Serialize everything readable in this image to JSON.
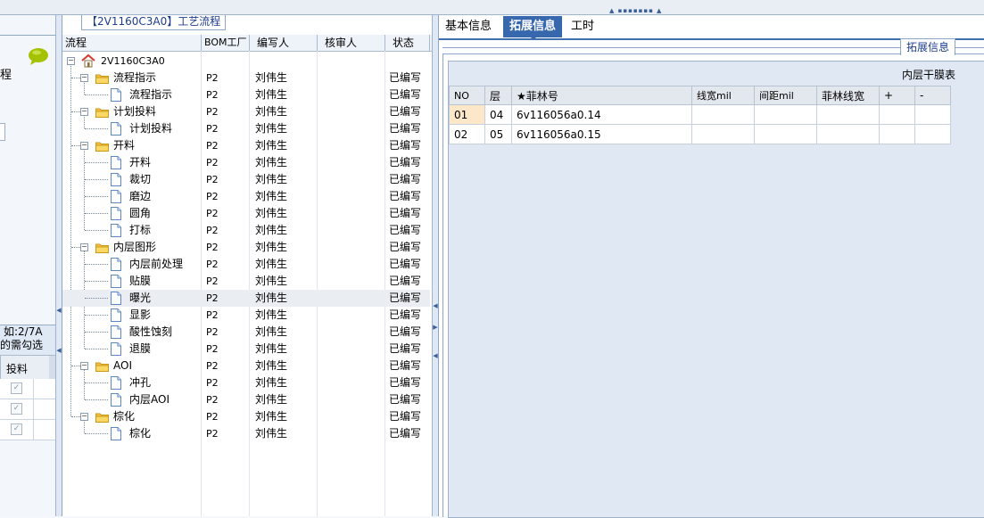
{
  "window": {
    "panel_title": "【2V1160C3A0】工艺流程"
  },
  "left_panel": {
    "label_cheng": "程",
    "hint_line1": "如:2/7A",
    "hint_line2": "的需勾选",
    "column_header": "投料",
    "rows": [
      {
        "checked": true
      },
      {
        "checked": true
      },
      {
        "checked": true
      }
    ]
  },
  "tree": {
    "headers": {
      "flow": "流程",
      "bom_factory": "BOM工厂",
      "author": "编写人",
      "reviewer": "核审人",
      "status": "状态"
    },
    "root": {
      "label": "2V1160C3A0"
    },
    "nodes": [
      {
        "label": "流程指示",
        "type": "folder",
        "bom": "P2",
        "author": "刘伟生",
        "reviewer": "",
        "status": "已编写"
      },
      {
        "label": "流程指示",
        "type": "doc",
        "bom": "P2",
        "author": "刘伟生",
        "reviewer": "",
        "status": "已编写"
      },
      {
        "label": "计划投料",
        "type": "folder",
        "bom": "P2",
        "author": "刘伟生",
        "reviewer": "",
        "status": "已编写"
      },
      {
        "label": "计划投料",
        "type": "doc",
        "bom": "P2",
        "author": "刘伟生",
        "reviewer": "",
        "status": "已编写"
      },
      {
        "label": "开料",
        "type": "folder",
        "bom": "P2",
        "author": "刘伟生",
        "reviewer": "",
        "status": "已编写"
      },
      {
        "label": "开料",
        "type": "doc",
        "bom": "P2",
        "author": "刘伟生",
        "reviewer": "",
        "status": "已编写"
      },
      {
        "label": "裁切",
        "type": "doc",
        "bom": "P2",
        "author": "刘伟生",
        "reviewer": "",
        "status": "已编写"
      },
      {
        "label": "磨边",
        "type": "doc",
        "bom": "P2",
        "author": "刘伟生",
        "reviewer": "",
        "status": "已编写"
      },
      {
        "label": "圆角",
        "type": "doc",
        "bom": "P2",
        "author": "刘伟生",
        "reviewer": "",
        "status": "已编写"
      },
      {
        "label": "打标",
        "type": "doc",
        "bom": "P2",
        "author": "刘伟生",
        "reviewer": "",
        "status": "已编写"
      },
      {
        "label": "内层图形",
        "type": "folder",
        "bom": "P2",
        "author": "刘伟生",
        "reviewer": "",
        "status": "已编写"
      },
      {
        "label": "内层前处理",
        "type": "doc",
        "bom": "P2",
        "author": "刘伟生",
        "reviewer": "",
        "status": "已编写"
      },
      {
        "label": "贴膜",
        "type": "doc",
        "bom": "P2",
        "author": "刘伟生",
        "reviewer": "",
        "status": "已编写"
      },
      {
        "label": "曝光",
        "type": "doc",
        "bom": "P2",
        "author": "刘伟生",
        "reviewer": "",
        "status": "已编写",
        "selected": true
      },
      {
        "label": "显影",
        "type": "doc",
        "bom": "P2",
        "author": "刘伟生",
        "reviewer": "",
        "status": "已编写"
      },
      {
        "label": "酸性蚀刻",
        "type": "doc",
        "bom": "P2",
        "author": "刘伟生",
        "reviewer": "",
        "status": "已编写"
      },
      {
        "label": "退膜",
        "type": "doc",
        "bom": "P2",
        "author": "刘伟生",
        "reviewer": "",
        "status": "已编写"
      },
      {
        "label": "AOI",
        "type": "folder",
        "bom": "P2",
        "author": "刘伟生",
        "reviewer": "",
        "status": "已编写"
      },
      {
        "label": "冲孔",
        "type": "doc",
        "bom": "P2",
        "author": "刘伟生",
        "reviewer": "",
        "status": "已编写"
      },
      {
        "label": "内层AOI",
        "type": "doc",
        "bom": "P2",
        "author": "刘伟生",
        "reviewer": "",
        "status": "已编写"
      },
      {
        "label": "棕化",
        "type": "folder",
        "bom": "P2",
        "author": "刘伟生",
        "reviewer": "",
        "status": "已编写"
      },
      {
        "label": "棕化",
        "type": "doc",
        "bom": "P2",
        "author": "刘伟生",
        "reviewer": "",
        "status": "已编写"
      }
    ]
  },
  "right_panel": {
    "tabs": [
      {
        "label": "基本信息",
        "active": false
      },
      {
        "label": "拓展信息",
        "active": true
      },
      {
        "label": "工时",
        "active": false
      }
    ],
    "group_label": "拓展信息",
    "grid_caption": "内层干膜表",
    "grid": {
      "headers": [
        "NO",
        "层",
        "★菲林号",
        "线宽mil",
        "间距mil",
        "菲林线宽",
        "+",
        "-"
      ],
      "rows": [
        [
          "01",
          "04",
          "6v116056a0.14",
          "",
          "",
          "",
          "",
          ""
        ],
        [
          "02",
          "05",
          "6v116056a0.15",
          "",
          "",
          "",
          "",
          ""
        ]
      ]
    }
  },
  "colors": {
    "accent": "#3767ad",
    "border": "#8ea6c6",
    "selected_cell": "#fce7c8"
  }
}
